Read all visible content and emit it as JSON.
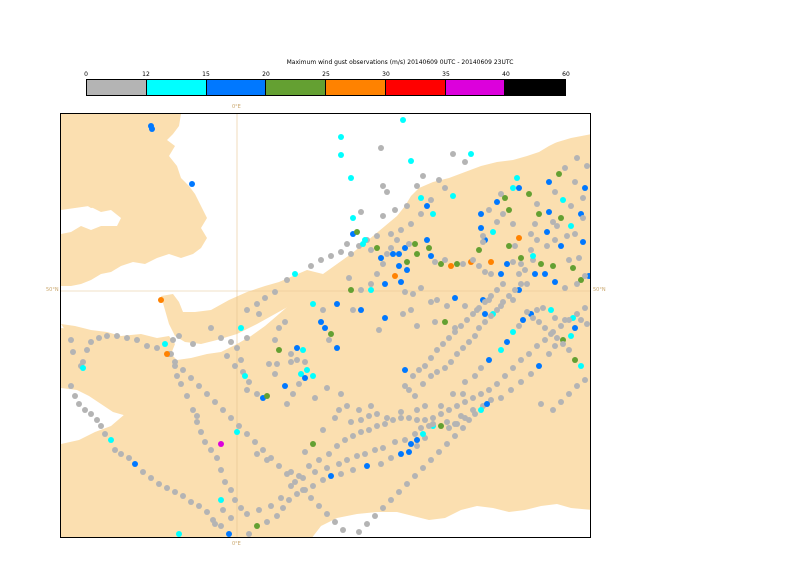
{
  "title": "Maximum wind gust observations (m/s) 20140609 0UTC - 20140609 23UTC",
  "legend": {
    "ticks": [
      "0",
      "12",
      "15",
      "20",
      "25",
      "30",
      "35",
      "40",
      "60"
    ],
    "colors": [
      "#b4b4b4",
      "#00ffff",
      "#0078ff",
      "#64a032",
      "#ff8200",
      "#ff0000",
      "#dc00dc",
      "#000000"
    ]
  },
  "map": {
    "land_color": "#fbdfb0",
    "sea_color": "#ffffff",
    "grid_labels": {
      "lon_top": "0°E",
      "lon_bottom": "0°E",
      "lat_left": "50°N",
      "lat_right": "50°N"
    }
  },
  "chart_data": {
    "type": "scatter",
    "categories_by_color": {
      "#b4b4b4": "0-12",
      "#00ffff": "12-15",
      "#0078ff": "15-20",
      "#64a032": "20-25",
      "#ff8200": "25-30",
      "#dc00dc": "35-40"
    }
  }
}
